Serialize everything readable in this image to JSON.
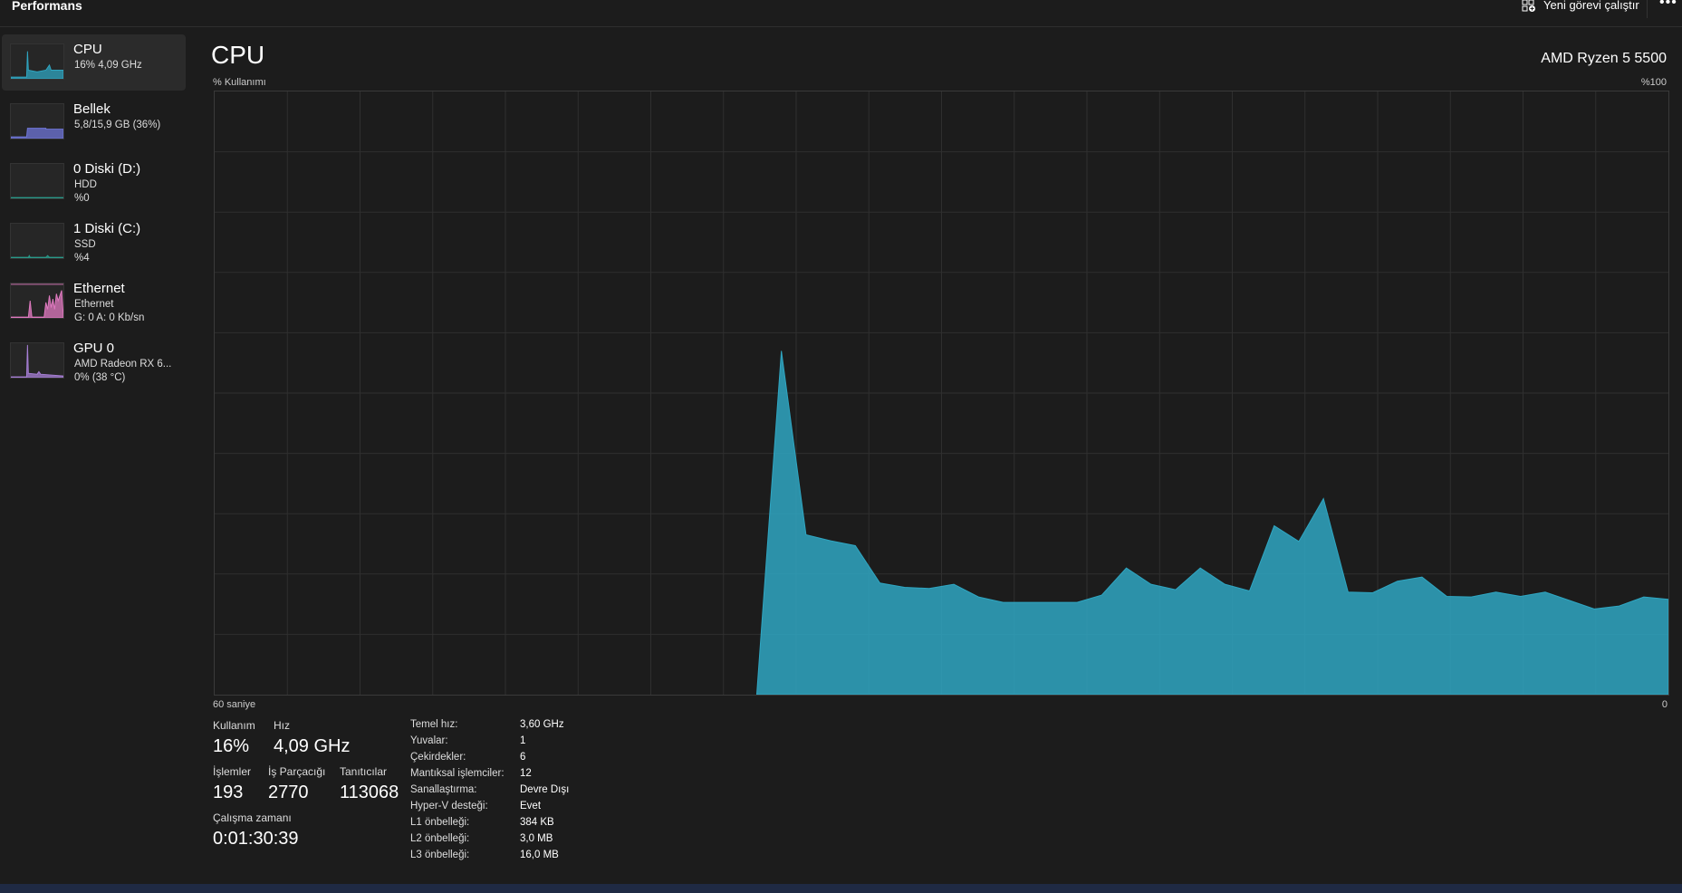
{
  "header": {
    "title": "Performans",
    "new_task": "Yeni görevi çalıştır",
    "more": "•••"
  },
  "sidebar": {
    "items": [
      {
        "name": "CPU",
        "sub1": "16% 4,09 GHz",
        "color": "#2fa6c2"
      },
      {
        "name": "Bellek",
        "sub1": "5,8/15,9 GB (36%)",
        "color": "#6f76d8"
      },
      {
        "name": "0 Diski (D:)",
        "sub1": "HDD",
        "sub2": "%0",
        "color": "#2a9a8a"
      },
      {
        "name": "1 Diski (C:)",
        "sub1": "SSD",
        "sub2": "%4",
        "color": "#2a9a8a"
      },
      {
        "name": "Ethernet",
        "sub1": "Ethernet",
        "sub2": "G: 0 A: 0 Kb/sn",
        "color": "#e07ac0"
      },
      {
        "name": "GPU 0",
        "sub1": "AMD Radeon RX 6...",
        "sub2": "0%  (38 °C)",
        "color": "#a77fd6"
      }
    ]
  },
  "main": {
    "title": "CPU",
    "model": "AMD Ryzen 5 5500"
  },
  "chart_data": {
    "type": "area",
    "title": "CPU",
    "ylabel": "% Kullanımı",
    "ymax_label": "%100",
    "xlabel_left": "60 saniye",
    "xlabel_right": "0",
    "ylim": [
      0,
      100
    ],
    "grid": true,
    "color": "#2fa6c2",
    "values": [
      0,
      0,
      0,
      0,
      0,
      0,
      0,
      0,
      0,
      0,
      0,
      0,
      0,
      0,
      0,
      0,
      0,
      0,
      0,
      0,
      0,
      0,
      0,
      57,
      26.5,
      25.5,
      24.7,
      18.5,
      17.8,
      17.6,
      18.3,
      16.2,
      15.3,
      15.3,
      15.3,
      15.3,
      16.5,
      21,
      18.3,
      17.4,
      21,
      18.3,
      17.2,
      28,
      25.4,
      32.5,
      17,
      16.9,
      18.8,
      19.5,
      16.3,
      16.2,
      17,
      16.3,
      17,
      15.6,
      14.2,
      14.7,
      16.2,
      15.8
    ]
  },
  "stats": {
    "usage_label": "Kullanım",
    "usage": "16%",
    "speed_label": "Hız",
    "speed": "4,09 GHz",
    "proc_label": "İşlemler",
    "proc": "193",
    "threads_label": "İş Parçacığı",
    "threads": "2770",
    "handles_label": "Tanıtıcılar",
    "handles": "113068",
    "uptime_label": "Çalışma zamanı",
    "uptime": "0:01:30:39"
  },
  "specs": [
    {
      "k": "Temel hız:",
      "v": "3,60 GHz"
    },
    {
      "k": "Yuvalar:",
      "v": "1"
    },
    {
      "k": "Çekirdekler:",
      "v": "6"
    },
    {
      "k": "Mantıksal işlemciler:",
      "v": "12"
    },
    {
      "k": "Sanallaştırma:",
      "v": "Devre Dışı"
    },
    {
      "k": "Hyper-V desteği:",
      "v": "Evet"
    },
    {
      "k": "L1 önbelleği:",
      "v": "384 KB"
    },
    {
      "k": "L2 önbelleği:",
      "v": "3,0 MB"
    },
    {
      "k": "L3 önbelleği:",
      "v": "16,0 MB"
    }
  ]
}
